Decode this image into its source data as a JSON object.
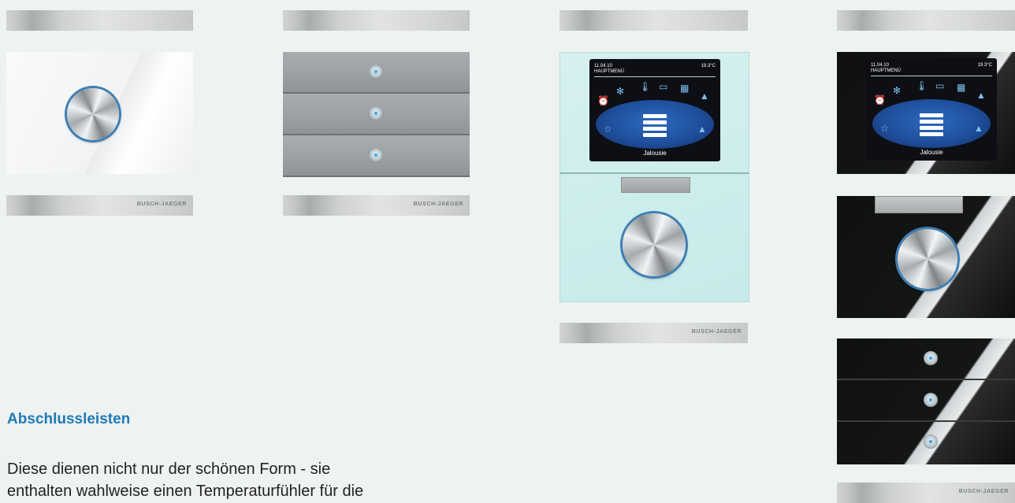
{
  "brand": "BUSCH-JAEGER",
  "display": {
    "date": "11.04.10",
    "menu": "HAUPTMENÜ",
    "temperature": "19.3°C",
    "caption": "Jalousie"
  },
  "section": {
    "heading": "Abschlussleisten",
    "body": "Diese dienen nicht nur der schönen Form - sie enthalten wahlweise einen Temperaturfühler für die"
  },
  "colors": {
    "accent": "#1f7ab8",
    "led": "#3aa6e0",
    "background": "#eef2f1"
  },
  "icons": [
    "alarm-clock-icon",
    "fan-icon",
    "thermometer-icon",
    "scene-icon",
    "window-icon",
    "lamp-icon",
    "tv-star-icon",
    "blinds-icon"
  ]
}
